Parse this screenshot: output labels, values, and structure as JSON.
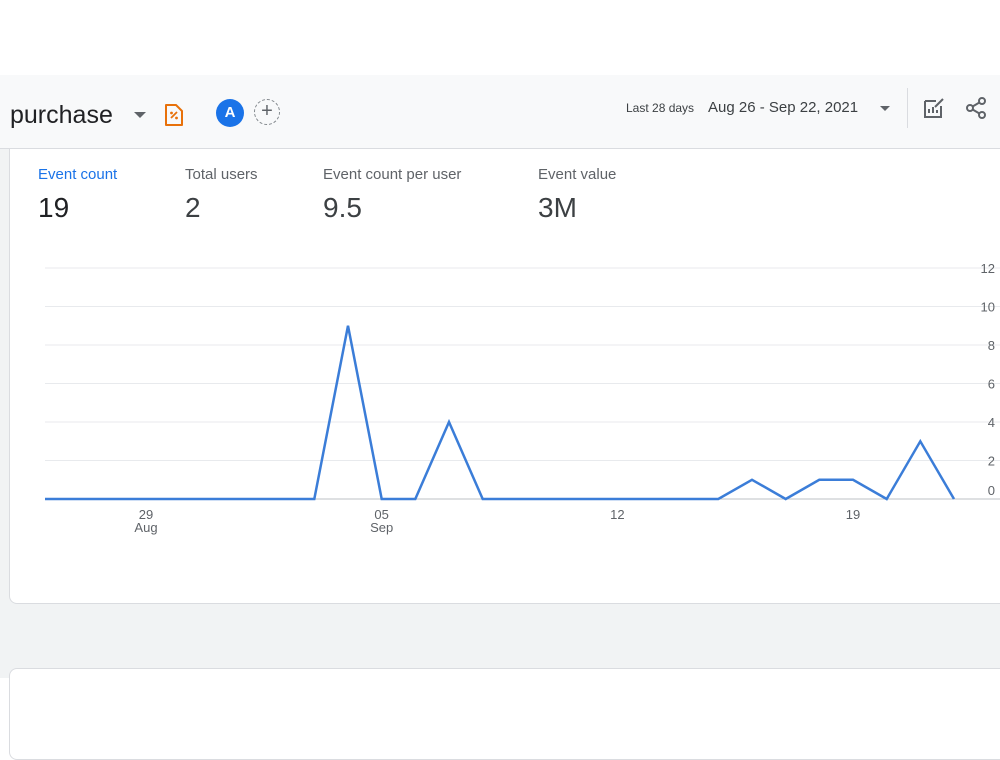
{
  "header": {
    "title": "purchase",
    "avatar_letter": "A",
    "add_label": "+",
    "range_label": "Last 28 days",
    "date_range": "Aug 26 - Sep 22, 2021"
  },
  "metrics": [
    {
      "label": "Event count",
      "value": "19",
      "active": true
    },
    {
      "label": "Total users",
      "value": "2"
    },
    {
      "label": "Event count per user",
      "value": "9.5"
    },
    {
      "label": "Event value",
      "value": "3M"
    }
  ],
  "colors": {
    "accent": "#1a73e8",
    "line": "#3b7dd8",
    "icon_orange": "#e8710a"
  },
  "icons": [
    "chevron-down-icon",
    "sheet-icon",
    "add-comparison-icon",
    "customize-report-icon",
    "share-icon"
  ],
  "chart_data": {
    "type": "line",
    "title": "",
    "xlabel": "",
    "ylabel": "",
    "x": [
      "Aug 26",
      "Aug 27",
      "Aug 28",
      "Aug 29",
      "Aug 30",
      "Aug 31",
      "Sep 01",
      "Sep 02",
      "Sep 03",
      "Sep 04",
      "Sep 05",
      "Sep 06",
      "Sep 07",
      "Sep 08",
      "Sep 09",
      "Sep 10",
      "Sep 11",
      "Sep 12",
      "Sep 13",
      "Sep 14",
      "Sep 15",
      "Sep 16",
      "Sep 17",
      "Sep 18",
      "Sep 19",
      "Sep 20",
      "Sep 21",
      "Sep 22"
    ],
    "series": [
      {
        "values": [
          0,
          0,
          0,
          0,
          0,
          0,
          0,
          0,
          0,
          9,
          0,
          0,
          4,
          0,
          0,
          0,
          0,
          0,
          0,
          0,
          0,
          1,
          0,
          1,
          1,
          0,
          3,
          0
        ]
      }
    ],
    "x_ticks": [
      {
        "day": "29",
        "month": "Aug",
        "index": 3
      },
      {
        "day": "05",
        "month": "Sep",
        "index": 10
      },
      {
        "day": "12",
        "month": "",
        "index": 17
      },
      {
        "day": "19",
        "month": "",
        "index": 24
      }
    ],
    "y_ticks": [
      "0",
      "2",
      "4",
      "6",
      "8",
      "10",
      "12"
    ],
    "ylim": [
      0,
      12
    ],
    "grid": true,
    "y_axis_side": "right"
  }
}
